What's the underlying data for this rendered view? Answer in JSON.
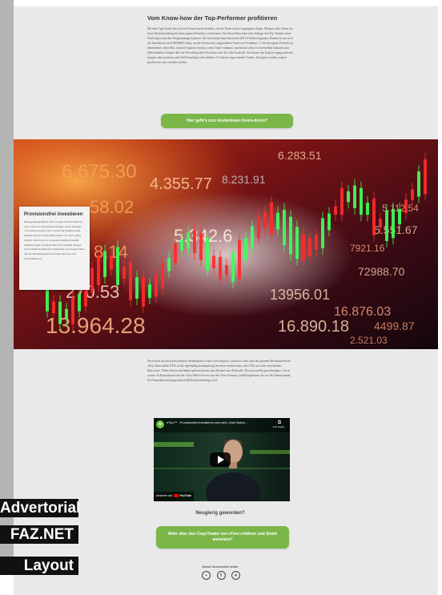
{
  "article": {
    "heading": "Vom Know-how der Top-Performer profitieren",
    "intro_text": "Mit dem CopyTrader lässt sich in Echtzeit nachvollziehen, welche Trader in den vergangenen Tagen, Monaten oder Jahren die beste Wertentwicklung bei ihren eigenen Portfolios verzeichnen. Auf dieser Basis kann jeder Anleger den Top-Tradern seiner Wahl folgen und ihre Anlagestrategie kopieren. Der Investment kann bereits bei 200 US-Dollar beginnen. Danach ist nur noch ein Tastendruck auf KOPIEREN nötig, um die Position des ausgewählten Traders im Verhältnis 1:1 für das eigene Portfolio zu übernehmen. Jeder Mal, wenn der kopierte Investor einen Trade vornimmt, macht man selbst es in derselben Sekunde nach. Dabei behalten Anleger über die Verwaltung ihres Portfolios stets die volle Kontrolle. Sie können den Kopiervorgang jederzeit stoppen oder pausieren und Geld hinzufügen oder abheben. Es können sogar einzelne Trades, die kopiert werden, separat geschlossen und verwaltet werden.",
    "cta_top": "Hier geht's zum kostenlosen Demo-Konto*",
    "body_text_2": "Doch nicht nur der provisionsfreie Aktienhandel ist mit eToro möglich, sondern es steht auch das gesamte Börsenuniversum offen. Dazu zählen ETFs, in die regelmäßig kostengünstig investiert werden kann, oder CFDs auf viele verschiedene Basiswerte. Neben Aktien und Indizes gehören hierzu zum Beispiel auch Rohstoffe, Devisen und Kryptowährungen. Gut zu wissen: In Deutschland wird der eToro Wallet-Service von der eToro Germany GmbH angeboten, die von der Bundesanstalt für Finanzdienstleistungsaufsicht (BaFin) beaufsichtigt wird.",
    "curious": "Neugierig geworden?",
    "cta_bottom": "Mehr über den CopyTrader von eToro erfahren und direkt anmelden*",
    "share_label": "Diese Geschichte teilen"
  },
  "info_box": {
    "title": "Provisionsfrei investieren",
    "text": "Managementgebühren oder sonstige Kosten fallen bei eToro nicht an. Erfolgreiche Anleger, deren Strategie von anderen kopiert wird, werden im Rahmen eines Popular-Investor-Programms direkt von eToro selbst bezahlt. Und stark vor weiterem Gebühren bezahlt niemand Angst zu haben: Bei eToro handeln Anleger sofort Aktien komplett provisionsfrei. Als Kosten fallen nur die Handelsspannen zwischen dem An- und Verkaufskurs an."
  },
  "hero": {
    "numbers": [
      "6.675.30",
      "58.02",
      "8.14",
      "270.53",
      "13.964.28",
      "4.355.77",
      "5.342.6",
      "6.283.51",
      "8.231.91",
      "13956.01",
      "16.890.18",
      "16.876.03",
      "5.551.67",
      "72988.70",
      "7921.16",
      "4499.87",
      "5.112.54",
      "2.521.03"
    ]
  },
  "video": {
    "channel_initial": "e",
    "title": "eToro™ - Provisionsfrei investieren und mehr. Zwei Sache...",
    "link_label": "Link kopier...",
    "watch_label": "Ansehen auf",
    "platform": "YouTube"
  },
  "share_icons": [
    {
      "name": "reddit-icon",
      "glyph": "◓"
    },
    {
      "name": "facebook-icon",
      "glyph": "f"
    },
    {
      "name": "twitter-icon",
      "glyph": "✦"
    }
  ],
  "tags": [
    "Advertorial",
    "FAZ.NET",
    "Layout"
  ],
  "colors": {
    "green": "#7ab648",
    "page_bg": "#e9e9e9"
  }
}
